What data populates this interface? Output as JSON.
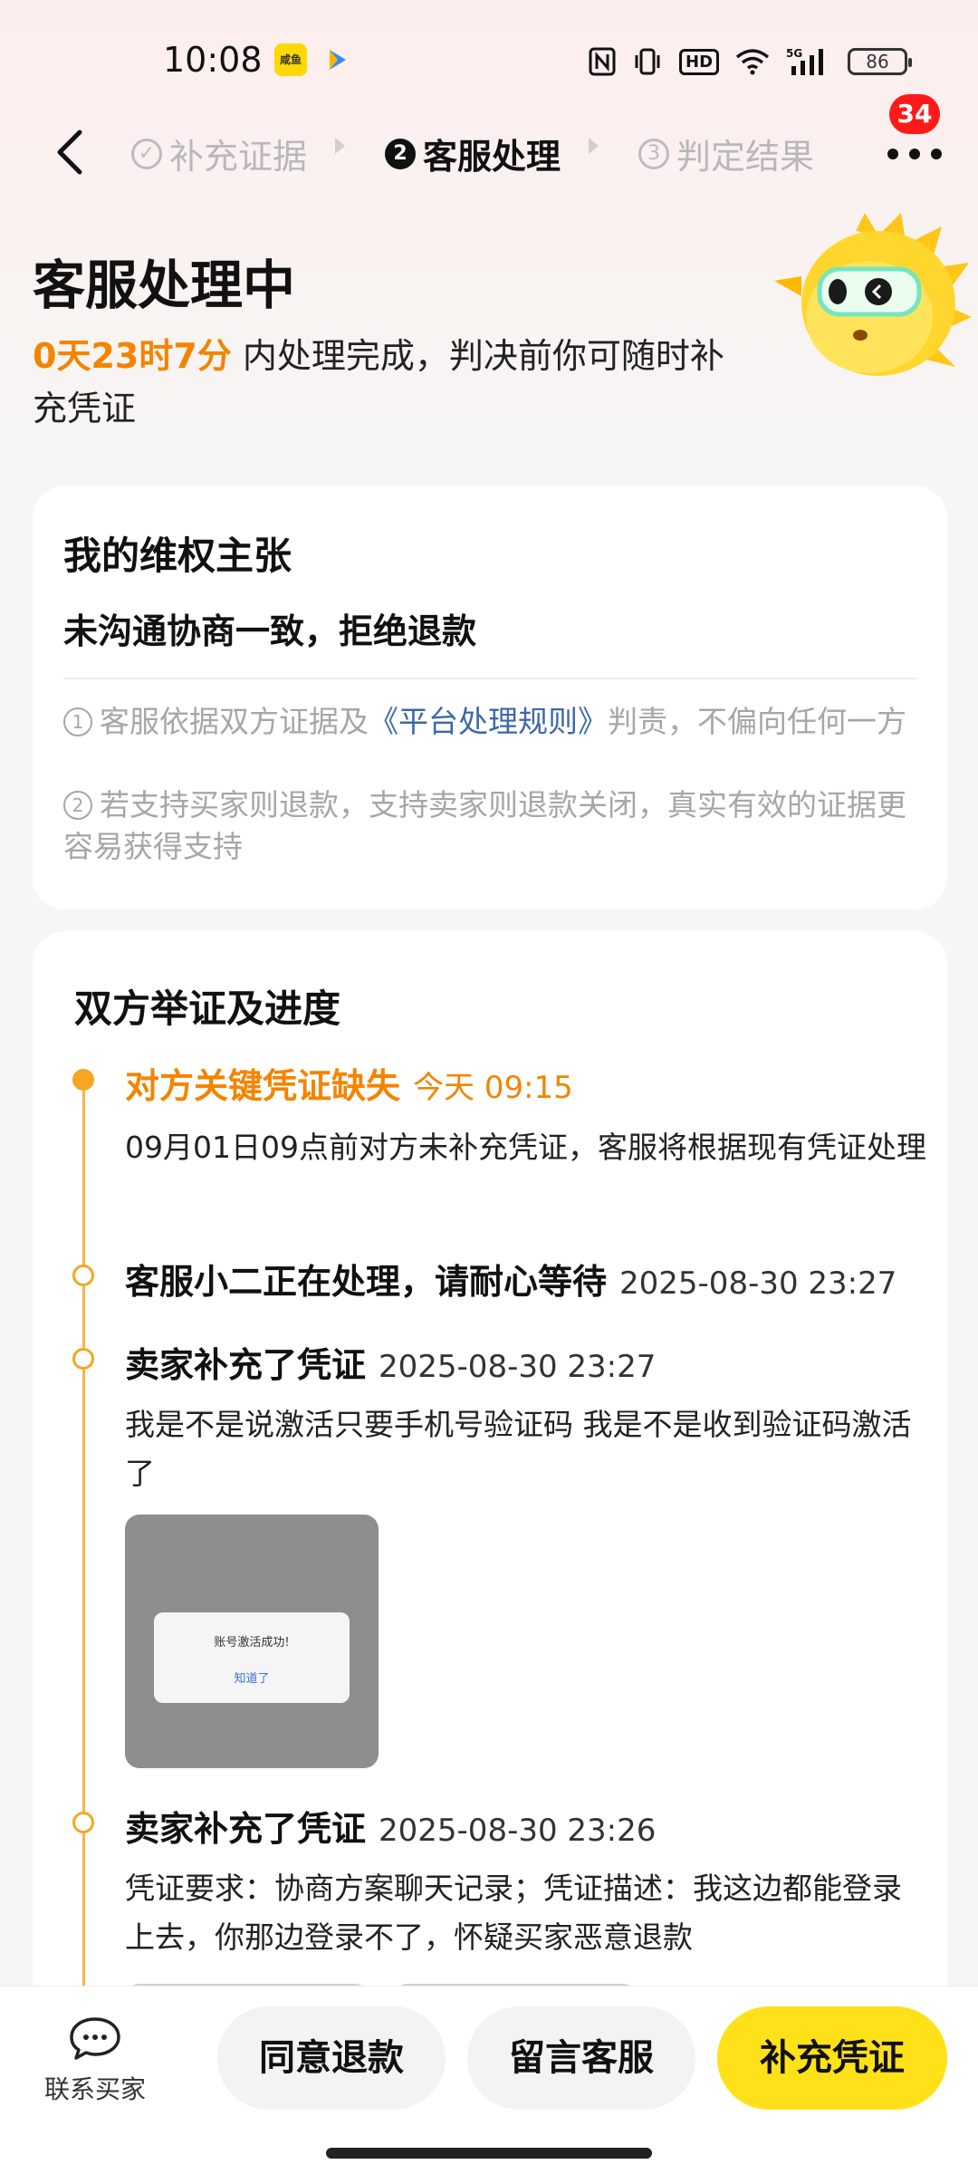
{
  "status_bar": {
    "time": "10:08",
    "app_icon_label": "咸鱼",
    "icons": [
      "nfc-icon",
      "vibrate-icon",
      "hd-icon",
      "wifi-icon",
      "signal-5g-icon",
      "battery-icon"
    ],
    "hd_label": "HD",
    "network_label": "5G",
    "battery": "86"
  },
  "nav": {
    "steps": [
      {
        "num": "✓",
        "label": "补充证据",
        "state": "done"
      },
      {
        "num": "2",
        "label": "客服处理",
        "state": "active"
      },
      {
        "num": "3",
        "label": "判定结果",
        "state": "pending"
      }
    ],
    "badge_count": "34"
  },
  "header": {
    "title": "客服处理中",
    "countdown": "0天23时7分",
    "subtitle_rest": " 内处理完成，判决前你可随时补充凭证"
  },
  "claim_card": {
    "title": "我的维权主张",
    "claim": "未沟通协商一致，拒绝退款",
    "note1_num": "1",
    "note1_before": "客服依据双方证据及",
    "note1_link": "《平台处理规则》",
    "note1_after": "判责，不偏向任何一方",
    "note2_num": "2",
    "note2_text": "若支持买家则退款，支持卖家则退款关闭，真实有效的证据更容易获得支持"
  },
  "progress_card": {
    "title": "双方举证及进度",
    "events": [
      {
        "head": "对方关键凭证缺失",
        "time": "今天 09:15",
        "body": "09月01日09点前对方未补充凭证，客服将根据现有凭证处理"
      },
      {
        "head": "客服小二正在处理，请耐心等待",
        "time": "2025-08-30 23:27",
        "body": ""
      },
      {
        "head": "卖家补充了凭证",
        "time": "2025-08-30 23:27",
        "body": "我是不是说激活只要手机号验证码 我是不是收到验证码激活了"
      },
      {
        "head": "卖家补充了凭证",
        "time": "2025-08-30 23:26",
        "body": "凭证要求：协商方案聊天记录；凭证描述：我这边都能登录上去，你那边登录不了，怀疑买家恶意退款"
      }
    ],
    "thumbnail": {
      "dialog_title": "账号激活成功!",
      "dialog_button": "知道了"
    }
  },
  "bottom_bar": {
    "contact_label": "联系买家",
    "agree_label": "同意退款",
    "message_label": "留言客服",
    "add_label": "补充凭证",
    "add_color": "#ffe11a"
  },
  "colors": {
    "accent_orange": "#f48400",
    "timeline": "#f5a623",
    "badge": "#ff1a1a",
    "link": "#3d68a8"
  }
}
